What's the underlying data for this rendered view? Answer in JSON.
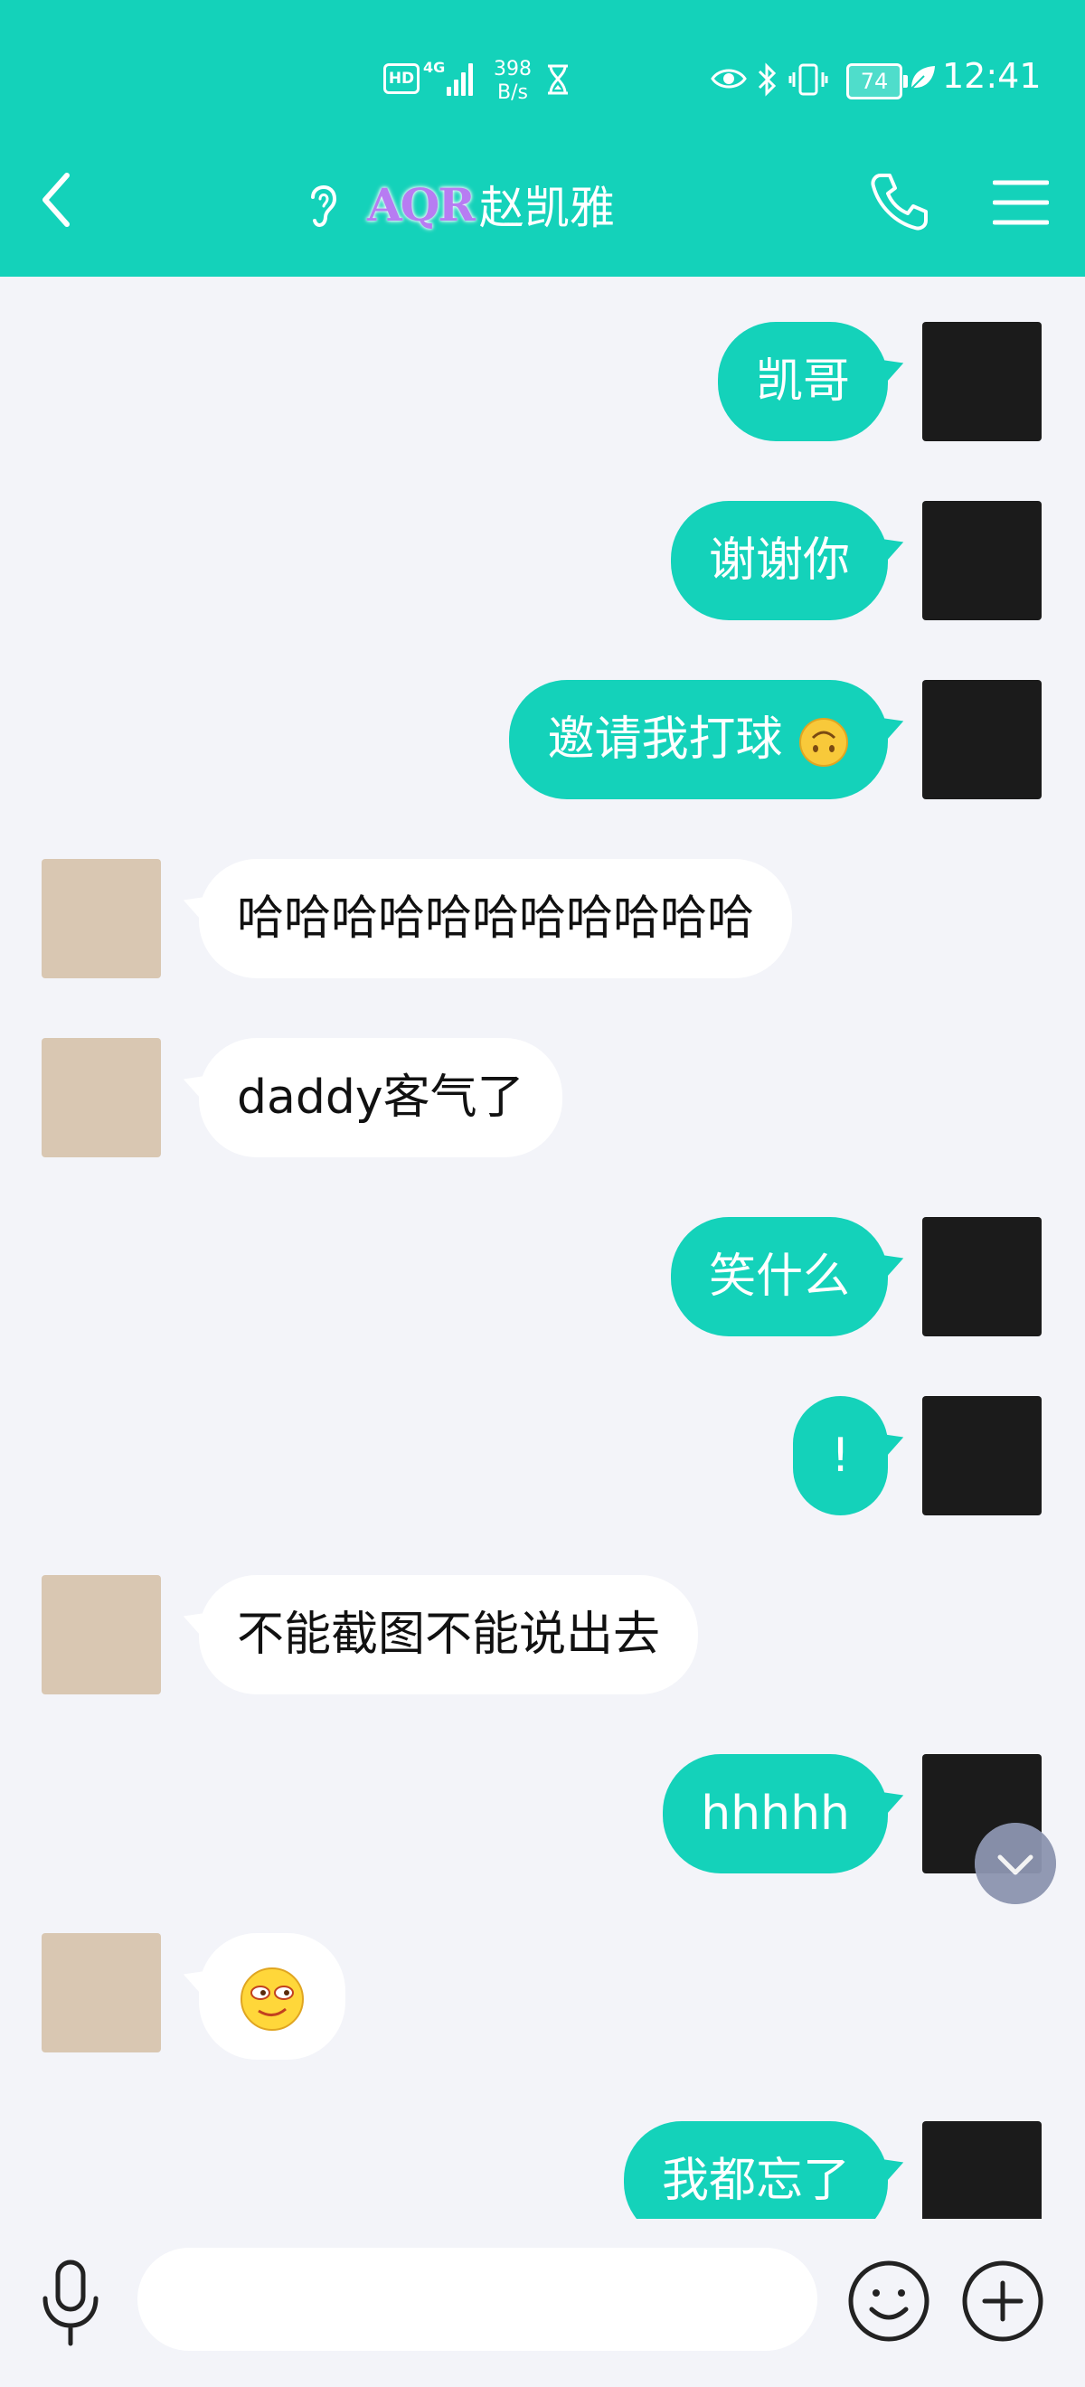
{
  "status_bar": {
    "hd": "HD",
    "network_type": "4G",
    "net_speed_value": "398",
    "net_speed_unit": "B/s",
    "battery": "74",
    "time": "12:41"
  },
  "header": {
    "title_badge": "AQR",
    "title": "赵凯雅",
    "icons": [
      "back-arrow-icon",
      "ear-icon",
      "phone-icon",
      "menu-icon"
    ]
  },
  "messages": [
    {
      "from": "me",
      "text": "凯哥"
    },
    {
      "from": "me",
      "text": "谢谢你"
    },
    {
      "from": "me",
      "text": "邀请我打球",
      "emoji": "upside-down-face"
    },
    {
      "from": "other",
      "text": "哈哈哈哈哈哈哈哈哈哈哈"
    },
    {
      "from": "other",
      "text": "daddy客气了"
    },
    {
      "from": "me",
      "text": "笑什么"
    },
    {
      "from": "me",
      "text": "!"
    },
    {
      "from": "other",
      "text": "不能截图不能说出去"
    },
    {
      "from": "me",
      "text": "hhhhh"
    },
    {
      "from": "other",
      "text": "",
      "emoji": "smirk-face"
    },
    {
      "from": "me",
      "text": "我都忘了"
    }
  ],
  "input_bar": {
    "placeholder": "",
    "icons": [
      "microphone-icon",
      "emoji-icon",
      "plus-icon"
    ]
  },
  "colors": {
    "accent": "#14d2ba",
    "background": "#f3f4f9",
    "bubble_other": "#ffffff"
  }
}
